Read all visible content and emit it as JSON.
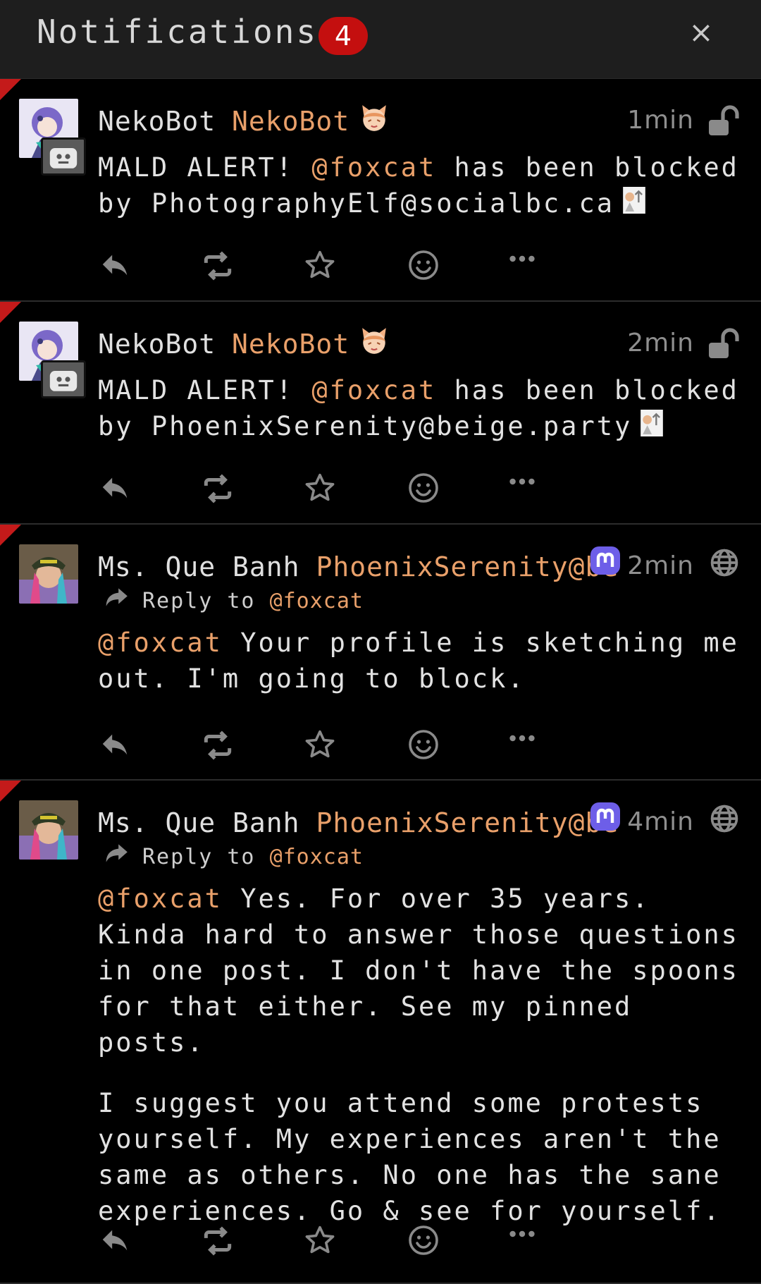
{
  "header": {
    "title": "Notifications",
    "badge_count": "4",
    "close_label": "×"
  },
  "colors": {
    "accent": "#e9a06a",
    "badge": "#c40f0f",
    "muted": "#8f8f8f"
  },
  "notifications": [
    {
      "display_name": "NekoBot",
      "account": "NekoBot",
      "time": "1min",
      "visibility_icon": "unlock-icon",
      "text_pre": "MALD ALERT! ",
      "mention": "@foxcat",
      "text_post": " has been blocked by PhotographyElf@socialbc.ca"
    },
    {
      "display_name": "NekoBot",
      "account": "NekoBot",
      "time": "2min",
      "visibility_icon": "unlock-icon",
      "text_pre": "MALD ALERT! ",
      "mention": "@foxcat",
      "text_post": " has been blocked by PhoenixSerenity@beige.party"
    },
    {
      "display_name": "Ms. Que Banh",
      "account": "PhoenixSerenity@be",
      "time": "2min",
      "visibility_icon": "globe-icon",
      "reply_label": "Reply to",
      "reply_account": "@foxcat",
      "mention": "@foxcat",
      "text_post": " Your profile is sketching me out. I'm going to block."
    },
    {
      "display_name": "Ms. Que Banh",
      "account": "PhoenixSerenity@be",
      "time": "4min",
      "visibility_icon": "globe-icon",
      "reply_label": "Reply to",
      "reply_account": "@foxcat",
      "mention": "@foxcat",
      "text_post": " Yes. For over 35 years. Kinda hard to answer those questions in one post. I don't have the spoons for that either. See my pinned posts.",
      "paragraph2": "I suggest you attend some protests yourself. My experiences aren't the same as others. No one has the sane experiences. Go & see for yourself."
    }
  ]
}
